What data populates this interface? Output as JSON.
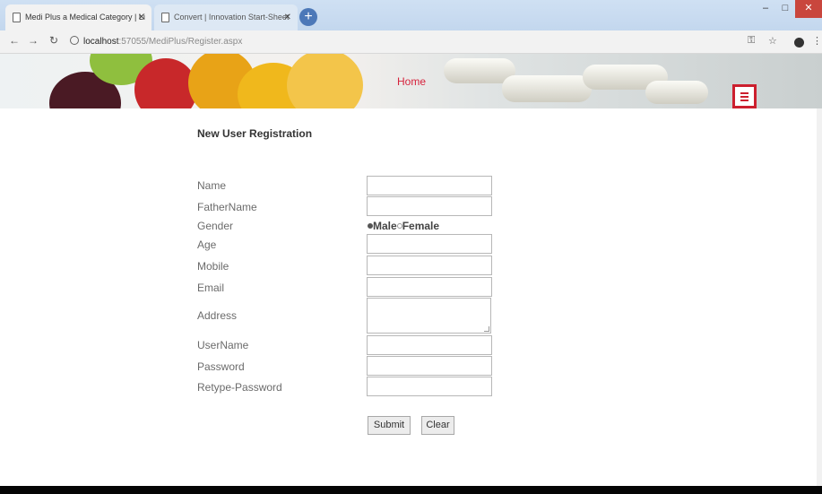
{
  "browser": {
    "tabs": [
      {
        "title": "Medi Plus a Medical Category | Li",
        "active": true
      },
      {
        "title": "Convert | Innovation Start-Sheet",
        "active": false
      }
    ],
    "url_host": "localhost",
    "url_path": ":57055/MediPlus/Register.aspx",
    "nav_icons": [
      "back-icon",
      "forward-icon",
      "reload-icon"
    ]
  },
  "header": {
    "nav_link": "Home",
    "accent_color": "#cc1f2e"
  },
  "form": {
    "title": "New User Registration",
    "fields": {
      "name": {
        "label": "Name",
        "value": ""
      },
      "fathername": {
        "label": "FatherName",
        "value": ""
      },
      "gender": {
        "label": "Gender",
        "options": [
          "Male",
          "Female"
        ],
        "selected": "Male"
      },
      "age": {
        "label": "Age",
        "value": ""
      },
      "mobile": {
        "label": "Mobile",
        "value": ""
      },
      "email": {
        "label": "Email",
        "value": ""
      },
      "address": {
        "label": "Address",
        "value": ""
      },
      "username": {
        "label": "UserName",
        "value": ""
      },
      "password": {
        "label": "Password",
        "value": ""
      },
      "retype": {
        "label": "Retype-Password",
        "value": ""
      }
    },
    "buttons": {
      "submit": "Submit",
      "clear": "Clear"
    }
  }
}
